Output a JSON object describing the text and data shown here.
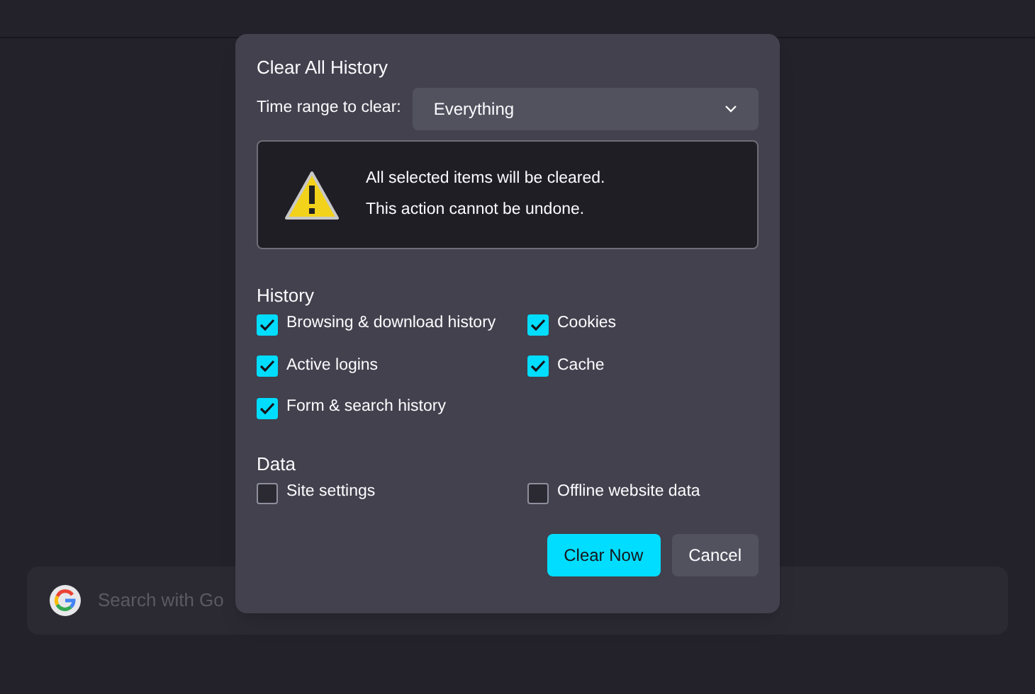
{
  "dialog": {
    "title": "Clear All History",
    "time_range": {
      "label": "Time range to clear:",
      "value": "Everything"
    },
    "warning": [
      "All selected items will be cleared.",
      "This action cannot be undone."
    ],
    "sections": [
      {
        "heading": "History",
        "items": [
          {
            "label": "Browsing & download history",
            "checked": true
          },
          {
            "label": "Cookies",
            "checked": true
          },
          {
            "label": "Active logins",
            "checked": true
          },
          {
            "label": "Cache",
            "checked": true
          },
          {
            "label": "Form & search history",
            "checked": true
          }
        ]
      },
      {
        "heading": "Data",
        "items": [
          {
            "label": "Site settings",
            "checked": false
          },
          {
            "label": "Offline website data",
            "checked": false
          }
        ]
      }
    ],
    "buttons": [
      {
        "label": "Clear Now",
        "kind": "primary"
      },
      {
        "label": "Cancel",
        "kind": "secondary"
      }
    ]
  },
  "search": {
    "placeholder": "Search with Go"
  }
}
